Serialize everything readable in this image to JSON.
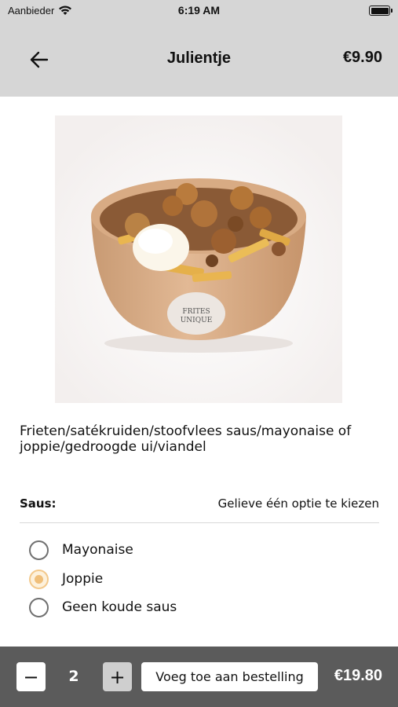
{
  "status_bar": {
    "carrier": "Aanbieder",
    "time": "6:19 AM"
  },
  "header": {
    "title": "Julientje",
    "price": "€9.90",
    "back_icon": "arrow-left-icon"
  },
  "product": {
    "description": "Frieten/satékruiden/stoofvlees saus/mayonaise of joppie/gedroogde ui/viandel",
    "logo_text_line1": "FRITES",
    "logo_text_line2": "UNIQUE"
  },
  "options": {
    "group_label": "Saus:",
    "hint": "Gelieve één optie te kiezen",
    "items": [
      {
        "label": "Mayonaise",
        "selected": false
      },
      {
        "label": "Joppie",
        "selected": true
      },
      {
        "label": "Geen koude saus",
        "selected": false
      }
    ]
  },
  "footer": {
    "minus_label": "−",
    "quantity": "2",
    "plus_label": "+",
    "add_label": "Voeg toe aan bestelling",
    "total": "€19.80"
  },
  "colors": {
    "header_bg": "#d6d6d6",
    "footer_bg": "#5b5b5b",
    "radio_selected": "#f0bf7a"
  }
}
